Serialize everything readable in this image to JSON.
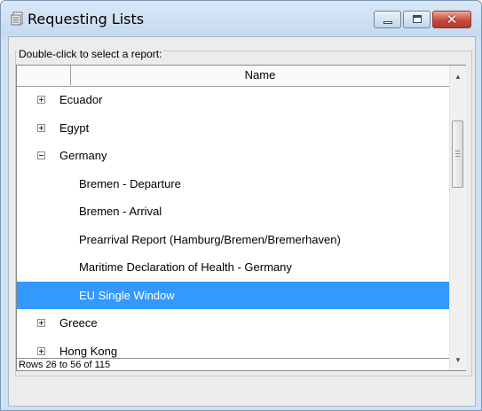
{
  "window": {
    "title": "Requesting Lists",
    "icon": "report-list-icon",
    "controls": {
      "minimize": "minimize-icon",
      "maximize": "maximize-icon",
      "close": "✕"
    },
    "close_color": "#c74b3c"
  },
  "group": {
    "label": "Double-click to select a report:"
  },
  "list": {
    "column_header": "Name",
    "rows": [
      {
        "label": "Ecuador",
        "expanded": false
      },
      {
        "label": "Egypt",
        "expanded": false
      },
      {
        "label": "Germany",
        "expanded": true
      },
      {
        "label": "Bremen - Departure"
      },
      {
        "label": "Bremen - Arrival"
      },
      {
        "label": "Prearrival Report (Hamburg/Bremen/Bremerhaven)"
      },
      {
        "label": "Maritime Declaration of Health - Germany"
      },
      {
        "label": "EU Single Window",
        "selected": true
      },
      {
        "label": "Greece",
        "expanded": false
      },
      {
        "label": "Hong Kong",
        "expanded": false
      }
    ],
    "selection_color": "#3399ff",
    "status": "Rows 26 to 56 of 115"
  }
}
